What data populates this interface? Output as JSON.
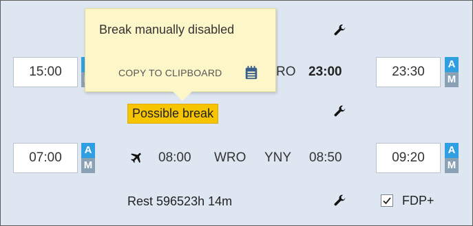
{
  "tooltip": {
    "title": "Break manually disabled",
    "copy_label": "COPY TO CLIPBOARD",
    "copy_icon": "clipboard-icon"
  },
  "row1": {
    "start_time": "15:00",
    "badge_a": "A",
    "badge_m": "M",
    "airport_partial": "RO",
    "arrival_time": "23:00",
    "end_time": "23:30",
    "end_badge_a": "A",
    "end_badge_m": "M"
  },
  "possible_break_label": "Possible break",
  "row2": {
    "start_time": "07:00",
    "badge_a": "A",
    "badge_m": "M",
    "departure_time": "08:00",
    "from": "WRO",
    "to": "YNY",
    "arrival_time": "08:50",
    "end_time": "09:20",
    "end_badge_a": "A",
    "end_badge_m": "M"
  },
  "rest_label": "Rest 596523h 14m",
  "fdp_label": "FDP+",
  "fdp_checked": true,
  "colors": {
    "panel_bg": "#dde6f1",
    "badge_a": "#2f9fe2",
    "badge_m": "#8aa1b5",
    "break_badge": "#f7c500",
    "tooltip_bg": "#fdf6c8"
  }
}
